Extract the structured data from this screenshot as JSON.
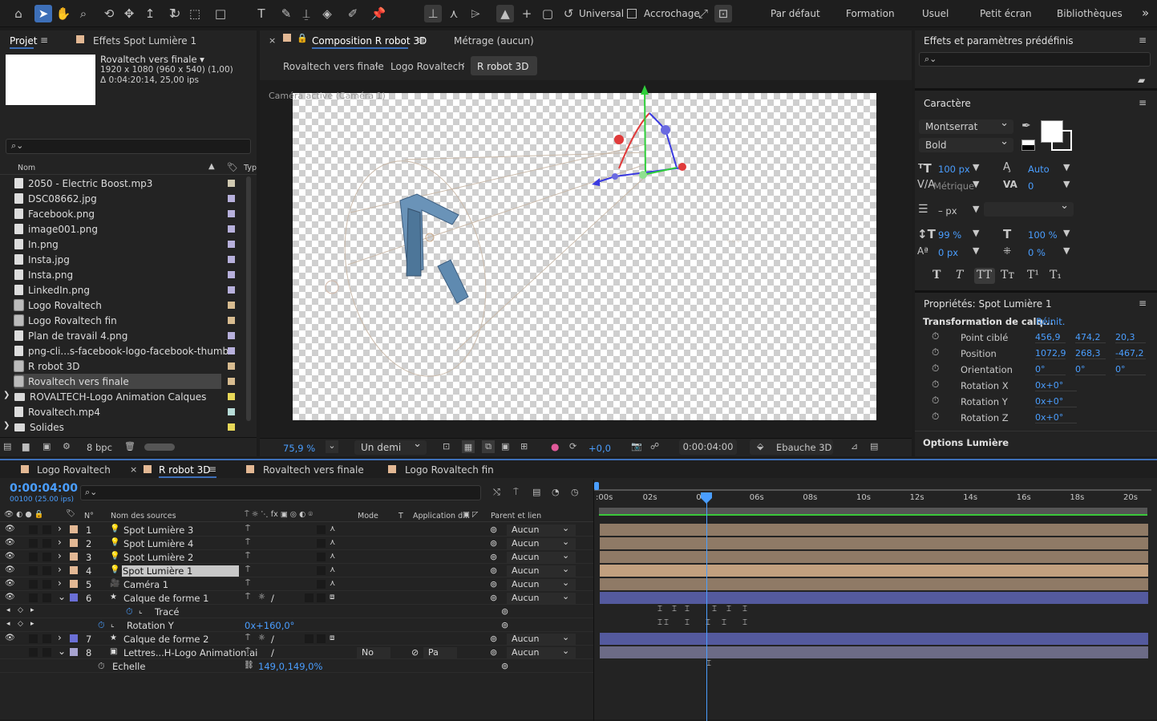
{
  "toolbar": {
    "icons": [
      "home-icon",
      "selection-icon",
      "hand-icon",
      "zoom-icon",
      "orbit-camera-icon",
      "pan-camera-icon",
      "dolly-camera-icon",
      "rotate-icon",
      "region-icon",
      "rectangle-icon",
      "text-icon",
      "brush-icon",
      "clone-stamp-icon",
      "eraser-icon",
      "roto-brush-icon",
      "puppet-pin-icon"
    ],
    "universal_label": "Universal",
    "snapping_label": "Accrochage",
    "workspaces": [
      "Par défaut",
      "Formation",
      "Usuel",
      "Petit écran",
      "Bibliothèques"
    ],
    "more": "»"
  },
  "project_panel": {
    "tab": "Projet",
    "effects_tab": "Effets  Spot Lumière 1",
    "info_name": "Rovaltech vers finale ▾",
    "info_line1": "1920 x 1080  (960 x 540) (1,00)",
    "info_line2": "Δ 0:04:20:14, 25,00 ips",
    "search_placeholder": "",
    "col_name": "Nom",
    "col_type": "Typ",
    "items": [
      {
        "name": "2050 - Electric Boost.mp3",
        "label_color": "#cfc8b0"
      },
      {
        "name": "DSC08662.jpg",
        "label_color": "#b7b0dc"
      },
      {
        "name": "Facebook.png",
        "label_color": "#b7b0dc"
      },
      {
        "name": "image001.png",
        "label_color": "#b7b0dc"
      },
      {
        "name": "In.png",
        "label_color": "#b7b0dc"
      },
      {
        "name": "Insta.jpg",
        "label_color": "#b7b0dc"
      },
      {
        "name": "Insta.png",
        "label_color": "#b7b0dc"
      },
      {
        "name": "LinkedIn.png",
        "label_color": "#b7b0dc"
      },
      {
        "name": "Logo Rovaltech",
        "label_color": "#d8bc90"
      },
      {
        "name": "Logo Rovaltech fin",
        "label_color": "#d8bc90"
      },
      {
        "name": "Plan de travail 4.png",
        "label_color": "#b7b0dc"
      },
      {
        "name": "png-cli...s-facebook-logo-facebook-thumbnail.png",
        "label_color": "#b7b0dc"
      },
      {
        "name": "R robot 3D",
        "label_color": "#d8bc90"
      },
      {
        "name": "Rovaltech vers finale",
        "label_color": "#d8bc90"
      },
      {
        "name": "ROVALTECH-Logo Animation Calques",
        "label_color": "#e8d858"
      },
      {
        "name": "Rovaltech.mp4",
        "label_color": "#b7dcd8"
      },
      {
        "name": "Solides",
        "label_color": "#e8d858"
      }
    ],
    "bpc": "8 bpc"
  },
  "comp_panel": {
    "tab": "Composition  R robot 3D",
    "footage_tab": "Métrage  (aucun)",
    "breadcrumbs": [
      "Rovaltech vers finale",
      "Logo Rovaltech",
      "R robot 3D"
    ],
    "camera_label": "Caméra active (Caméra 1)",
    "zoom": "75,9  %",
    "resolution": "Un demi",
    "exposure": "+0,0",
    "timecode": "0:00:04:00",
    "renderer": "Ebauche 3D"
  },
  "right_panel": {
    "effects_title": "Effets et paramètres prédéfinis",
    "char_title": "Caractère",
    "font": "Montserrat",
    "style": "Bold",
    "size": "100 px",
    "leading": "Auto",
    "kerning": "Métrique",
    "tracking": "0",
    "stroke": "– px",
    "vscale": "99 %",
    "hscale": "100 %",
    "baseline": "0 px",
    "tsume": "0 %",
    "fmt_buttons": [
      "T",
      "T",
      "TT",
      "Tт",
      "T¹",
      "T₁"
    ],
    "props_title": "Propriétés: Spot Lumière 1",
    "transform_title": "Transformation de calq...",
    "reset": "Réinit.",
    "props": [
      {
        "label": "Point ciblé",
        "v": [
          "456,9",
          "474,2",
          "20,3"
        ]
      },
      {
        "label": "Position",
        "v": [
          "1072,9",
          "268,3",
          "-467,2"
        ]
      },
      {
        "label": "Orientation",
        "v": [
          "0°",
          "0°",
          "0°"
        ]
      },
      {
        "label": "Rotation X",
        "v": [
          "0x+0°"
        ]
      },
      {
        "label": "Rotation Y",
        "v": [
          "0x+0°"
        ]
      },
      {
        "label": "Rotation Z",
        "v": [
          "0x+0°"
        ]
      }
    ],
    "light_options": "Options Lumière"
  },
  "timeline": {
    "tabs": [
      "Logo Rovaltech",
      "R robot 3D",
      "Rovaltech vers finale",
      "Logo Rovaltech fin"
    ],
    "timecode": "0:00:04:00",
    "timecode_sub": "00100 (25.00 ips)",
    "col_num": "N°",
    "col_name": "Nom des sources",
    "col_mode": "Mode",
    "col_t": "T",
    "col_app": "Application d...",
    "col_parent": "Parent et lien",
    "ruler": [
      ":00s",
      "02s",
      "04s",
      "06s",
      "08s",
      "10s",
      "12s",
      "14s",
      "16s",
      "18s",
      "20s"
    ],
    "layers": [
      {
        "n": "1",
        "name": "Spot Lumière 3",
        "parent": "Aucun",
        "label": "#e3b894"
      },
      {
        "n": "2",
        "name": "Spot Lumière 4",
        "parent": "Aucun",
        "label": "#e3b894"
      },
      {
        "n": "3",
        "name": "Spot Lumière 2",
        "parent": "Aucun",
        "label": "#e3b894"
      },
      {
        "n": "4",
        "name": "Spot Lumière 1",
        "parent": "Aucun",
        "label": "#e3b894"
      },
      {
        "n": "5",
        "name": "Caméra 1",
        "parent": "Aucun",
        "label": "#e3b894"
      },
      {
        "n": "6",
        "name": "Calque de forme 1",
        "parent": "Aucun",
        "label": "#6a6fd6"
      },
      {
        "n": "",
        "name": "Tracé",
        "parent": "",
        "label": ""
      },
      {
        "n": "",
        "name": "Rotation Y",
        "parent": "",
        "label": "",
        "value": "0x+160,0°"
      },
      {
        "n": "7",
        "name": "Calque de forme 2",
        "parent": "Aucun",
        "label": "#6a6fd6"
      },
      {
        "n": "8",
        "name": "Lettres...H-Logo Animation.ai",
        "parent": "Aucun",
        "label": "#a7a3d0",
        "mode": "No",
        "app": "Pa"
      },
      {
        "n": "",
        "name": "Echelle",
        "parent": "",
        "label": "",
        "value": "149,0,149,0%"
      }
    ]
  }
}
